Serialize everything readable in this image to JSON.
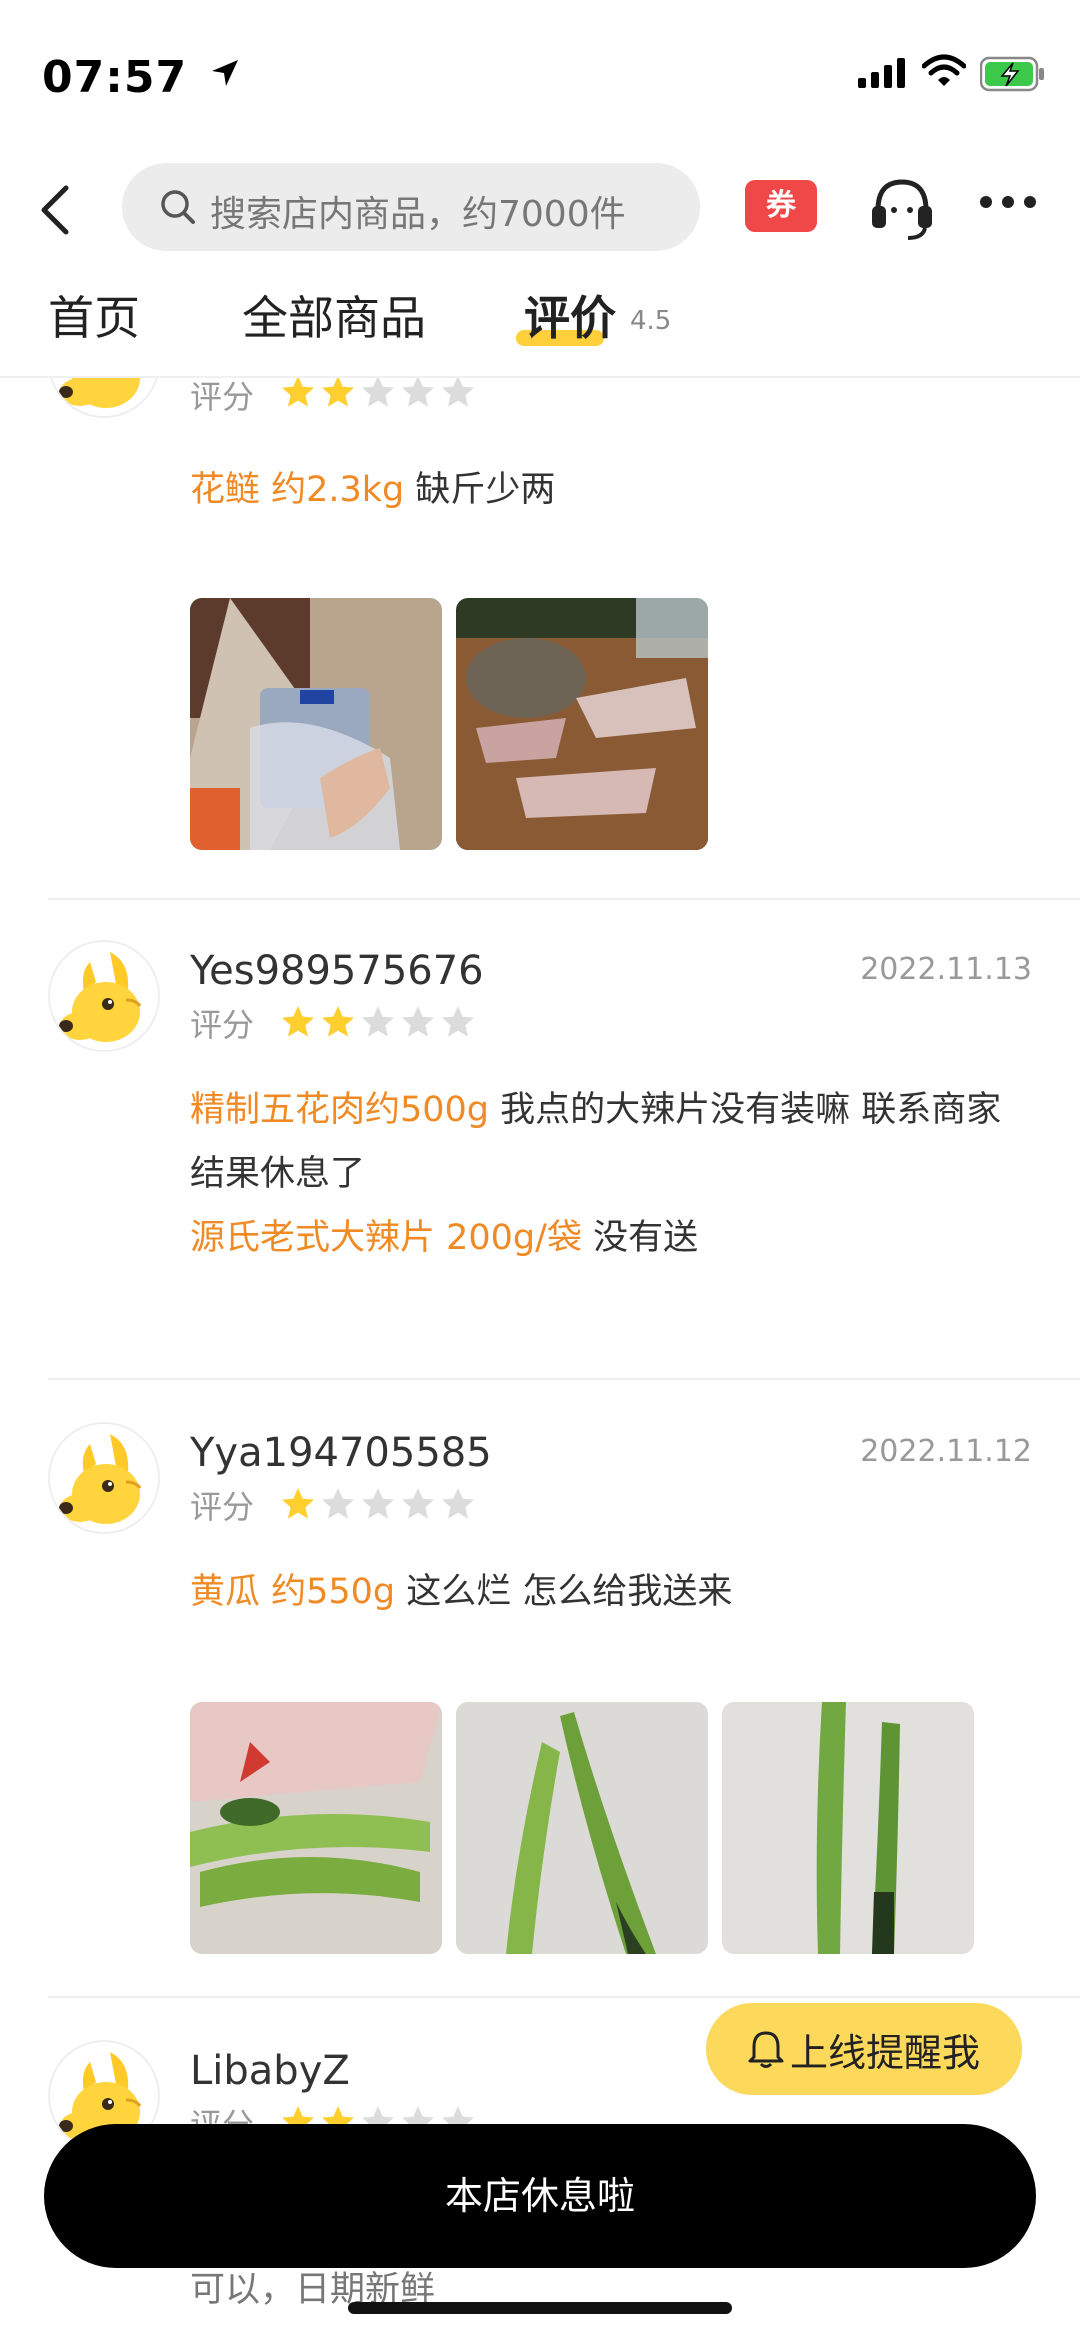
{
  "status_bar": {
    "time": "07:57"
  },
  "header": {
    "search_placeholder": "搜索店内商品，约7000件",
    "coupon_label": "券"
  },
  "tabs": {
    "home": "首页",
    "all_products": "全部商品",
    "reviews": "评价",
    "review_score": "4.5"
  },
  "reviews": [
    {
      "username": "",
      "date": "",
      "score_label": "评分",
      "stars": 2,
      "lines": [
        {
          "product": "花鲢 约2.3kg",
          "text": " 缺斤少两"
        }
      ],
      "photos": [
        "scale-photo",
        "fish-photo"
      ]
    },
    {
      "username": "Yes989575676",
      "date": "2022.11.13",
      "score_label": "评分",
      "stars": 2,
      "lines": [
        {
          "product": "精制五花肉约500g",
          "text": " 我点的大辣片没有装嘛  联系商家结果休息了"
        },
        {
          "product": "源氏老式大辣片 200g/袋",
          "text": " 没有送"
        }
      ],
      "photos": []
    },
    {
      "username": "Yya194705585",
      "date": "2022.11.12",
      "score_label": "评分",
      "stars": 1,
      "lines": [
        {
          "product": "黄瓜 约550g",
          "text": " 这么烂 怎么给我送来"
        }
      ],
      "photos": [
        "cucumber-bag-photo",
        "cucumber-photo",
        "cucumber-photo"
      ]
    },
    {
      "username": "LibabyZ",
      "date": "",
      "score_label": "评分",
      "stars": 2,
      "lines": [
        {
          "product": "",
          "text": "可以，日期新鲜"
        }
      ],
      "photos": []
    }
  ],
  "remind_button": "上线提醒我",
  "closed_bar": "本店休息啦",
  "colors": {
    "accent_yellow": "#ffd03a",
    "product_orange": "#f08a24",
    "coupon_red": "#f04848",
    "star_gold": "#ffcf2e",
    "star_gray": "#dcdcdc"
  }
}
